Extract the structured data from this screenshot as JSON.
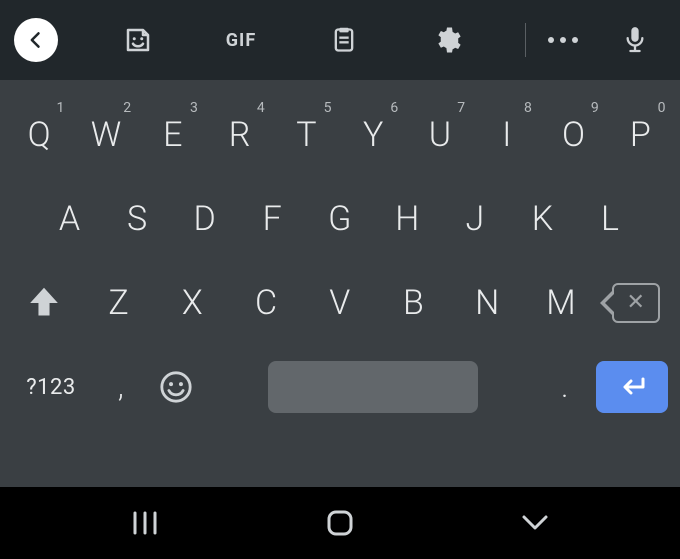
{
  "toolbar": {
    "gif_label": "GIF"
  },
  "keyboard": {
    "row1": [
      {
        "main": "Q",
        "hint": "1"
      },
      {
        "main": "W",
        "hint": "2"
      },
      {
        "main": "E",
        "hint": "3"
      },
      {
        "main": "R",
        "hint": "4"
      },
      {
        "main": "T",
        "hint": "5"
      },
      {
        "main": "Y",
        "hint": "6"
      },
      {
        "main": "U",
        "hint": "7"
      },
      {
        "main": "I",
        "hint": "8"
      },
      {
        "main": "O",
        "hint": "9"
      },
      {
        "main": "P",
        "hint": "0"
      }
    ],
    "row2": [
      "A",
      "S",
      "D",
      "F",
      "G",
      "H",
      "J",
      "K",
      "L"
    ],
    "row3": [
      "Z",
      "X",
      "C",
      "V",
      "B",
      "N",
      "M"
    ],
    "symbols_label": "?123",
    "comma": ",",
    "period": ".",
    "backspace_x": "✕"
  },
  "colors": {
    "accent": "#5b8def",
    "kbd_bg": "#3a3f43",
    "toolbar_bg": "#21272b"
  }
}
